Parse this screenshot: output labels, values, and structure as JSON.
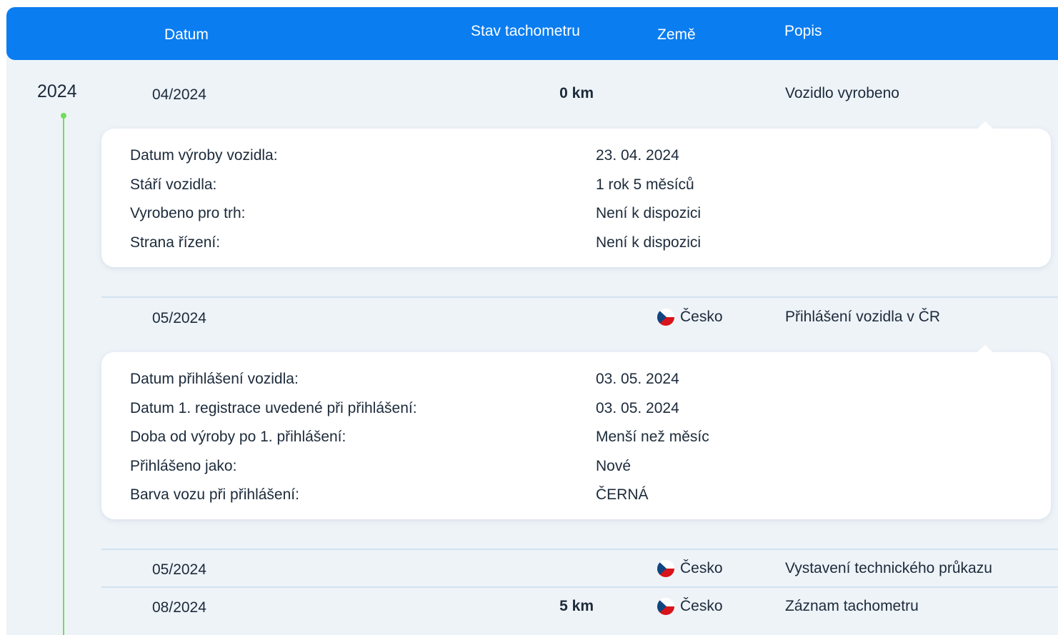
{
  "header": {
    "datum": "Datum",
    "stav": "Stav tachometru",
    "zeme": "Země",
    "popis": "Popis"
  },
  "year": "2024",
  "rows": [
    {
      "date": "04/2024",
      "km": "0 km",
      "country": "",
      "desc": "Vozidlo vyrobeno"
    },
    {
      "date": "05/2024",
      "km": "",
      "country": "Česko",
      "desc": "Přihlášení vozidla v ČR"
    },
    {
      "date": "05/2024",
      "km": "",
      "country": "Česko",
      "desc": "Vystavení technického průkazu"
    },
    {
      "date": "08/2024",
      "km": "5 km",
      "country": "Česko",
      "desc": "Záznam tachometru"
    }
  ],
  "card1": [
    {
      "label": "Datum výroby vozidla:",
      "value": "23. 04. 2024"
    },
    {
      "label": "Stáří vozidla:",
      "value": "1 rok 5 měsíců"
    },
    {
      "label": "Vyrobeno pro trh:",
      "value": "Není k dispozici"
    },
    {
      "label": "Strana řízení:",
      "value": "Není k dispozici"
    }
  ],
  "card2": [
    {
      "label": "Datum přihlášení vozidla:",
      "value": "03. 05. 2024"
    },
    {
      "label": "Datum 1. registrace uvedené při přihlášení:",
      "value": "03. 05. 2024"
    },
    {
      "label": "Doba od výroby po 1. přihlášení:",
      "value": "Menší než měsíc"
    },
    {
      "label": "Přihlášeno jako:",
      "value": "Nové"
    },
    {
      "label": "Barva vozu při přihlášení:",
      "value": "ČERNÁ"
    }
  ],
  "colors": {
    "header": "#0a7df0",
    "timeline": "#6fde5a",
    "background": "#eef3f8"
  }
}
